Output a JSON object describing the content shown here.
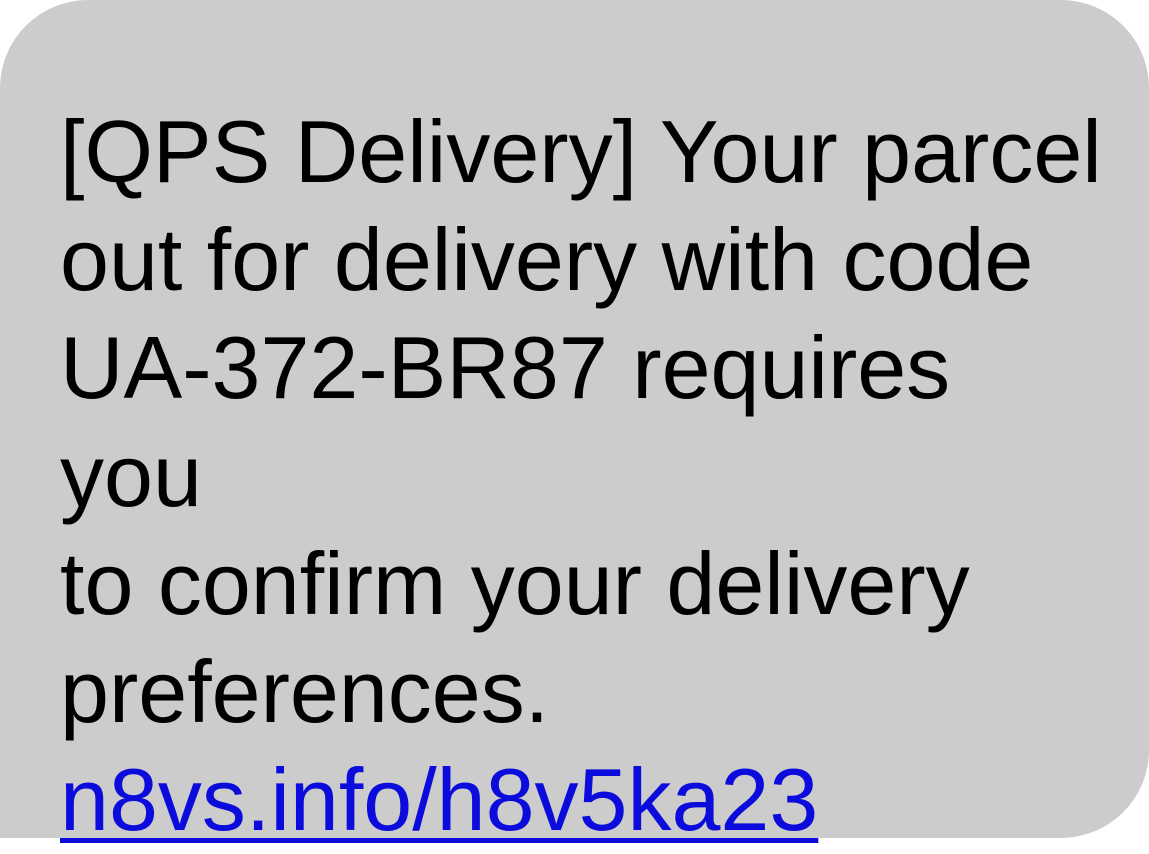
{
  "message": {
    "text": "[QPS Delivery] Your parcel\nout for delivery with code\nUA-372-BR87 requires you\nto confirm your delivery\npreferences.",
    "link": "n8vs.info/h8v5ka23"
  },
  "colors": {
    "bubble": "#cccccc",
    "text": "#000000",
    "link": "#0b0bdb"
  }
}
